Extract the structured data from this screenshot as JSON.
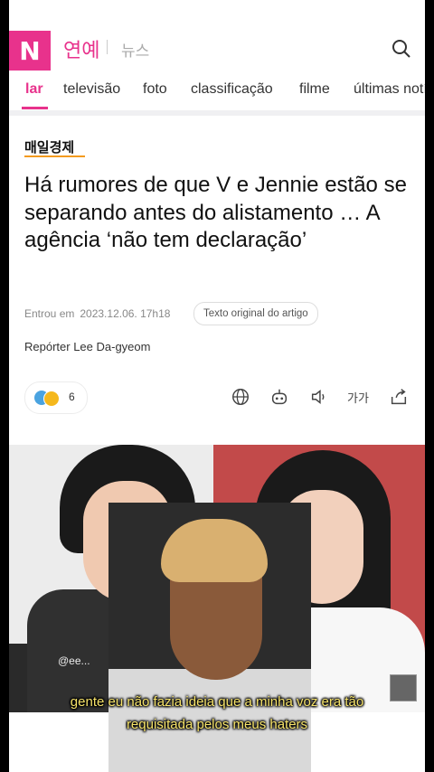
{
  "header": {
    "logo": "N",
    "section": "연예",
    "sub": "뉴스"
  },
  "tabs": [
    "lar",
    "televisão",
    "foto",
    "classificação",
    "filme",
    "últimas notícias"
  ],
  "article": {
    "source": "매일경제",
    "headline": "Há rumores de que V e Jennie estão se separando antes do alistamento … A agência ‘não tem declaração’",
    "entered_label": "Entrou em",
    "entered_date": "2023.12.06. 17h18",
    "original_text_badge": "Texto original do artigo",
    "reporter": "Repórter Lee Da-gyeom"
  },
  "reactions": {
    "count": "6"
  },
  "toolbar": {
    "font_size_label": "가가"
  },
  "photo": {
    "watermark": "@ee..."
  },
  "overlay": {
    "caption_line1": "gente eu não fazia ideia que a minha voz era tão",
    "caption_line2": "requisitada pelos meus haters"
  },
  "colors": {
    "accent": "#e8328c",
    "source_underline": "#f39a1f",
    "caption": "#f6e36a"
  }
}
